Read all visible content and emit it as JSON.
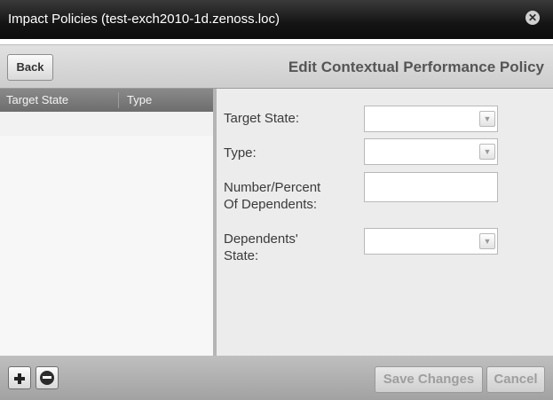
{
  "dialog": {
    "title": "Impact Policies (test-exch2010-1d.zenoss.loc)",
    "close_icon": "close-icon"
  },
  "toolbar": {
    "back_label": "Back",
    "edit_title": "Edit Contextual Performance Policy"
  },
  "grid": {
    "columns": [
      "Target State",
      "Type"
    ],
    "rows": []
  },
  "form": {
    "target_state_label": "Target State:",
    "target_state_value": "",
    "type_label": "Type:",
    "type_value": "",
    "number_percent_label_line1": "Number/Percent",
    "number_percent_label_line2": "Of Dependents:",
    "number_percent_value": "",
    "dependents_state_label_line1": "Dependents'",
    "dependents_state_label_line2": "State:",
    "dependents_state_value": ""
  },
  "footer": {
    "add_icon": "plus-icon",
    "remove_icon": "minus-icon",
    "save_label": "Save Changes",
    "cancel_label": "Cancel"
  }
}
